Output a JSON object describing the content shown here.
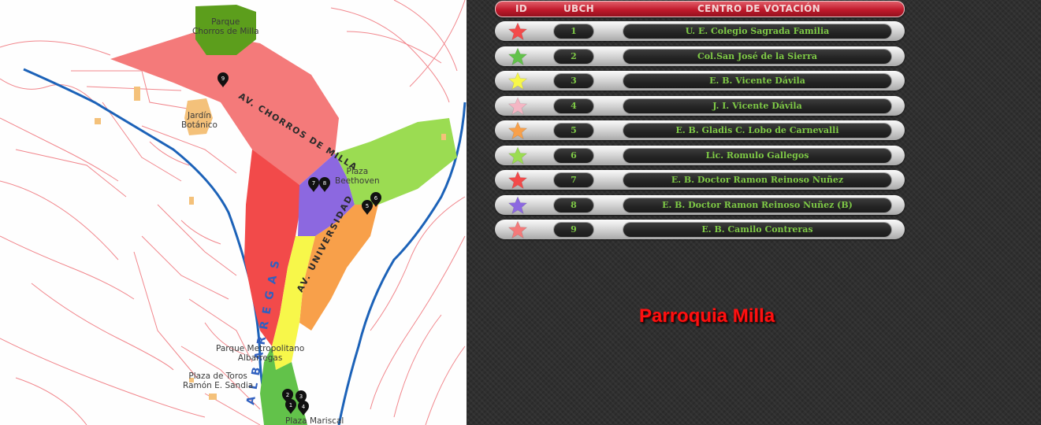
{
  "map": {
    "labels": {
      "parque_chorros": "Parque\nChorros de Milla",
      "jardin": "Jardín\nBotánico",
      "plaza_beethoven": "Plaza\nBeethoven",
      "parque_metropolitano": "Parque Metropolitano\nAlbarregas",
      "plaza_toros": "Plaza de Toros\nRamón E. Sandia",
      "plaza_bottom": "Plaza Mariscal"
    },
    "streets": {
      "chorros": "AV. CHORROS DE MILLA",
      "universidad": "AV. UNIVERSIDAD",
      "albarregas": "ALBARREGAS"
    },
    "markers": [
      "1",
      "2",
      "3",
      "4",
      "5",
      "6",
      "7",
      "8",
      "9"
    ]
  },
  "table": {
    "headers": {
      "id": "ID",
      "ubch": "UBCH",
      "centro": "CENTRO DE VOTACIÓN"
    },
    "rows": [
      {
        "id": "1",
        "name": "U. E. Colegio Sagrada Familia",
        "star_color": "#f24a4a"
      },
      {
        "id": "2",
        "name": "Col.San José de la Sierra",
        "star_color": "#62c24a"
      },
      {
        "id": "3",
        "name": "E. B. Vicente Dávila",
        "star_color": "#f7f74a"
      },
      {
        "id": "4",
        "name": "J. I. Vicente Dávila",
        "star_color": "#f4b6c4"
      },
      {
        "id": "5",
        "name": "E. B. Gladis C. Lobo de Carnevalli",
        "star_color": "#f8a04a"
      },
      {
        "id": "6",
        "name": "Lic. Romulo Gallegos",
        "star_color": "#9bdc52"
      },
      {
        "id": "7",
        "name": "E. B. Doctor Ramon Reinoso Nuñez",
        "star_color": "#f24a4a"
      },
      {
        "id": "8",
        "name": "E. B. Doctor Ramon Reinoso Nuñez (B)",
        "star_color": "#8c68e0"
      },
      {
        "id": "9",
        "name": "E. B. Camilo Contreras",
        "star_color": "#f47a7a"
      }
    ]
  },
  "title": "Parroquia Milla",
  "colors": {
    "title_red": "#ff1010",
    "name_green": "#7ec946",
    "header_red": "#c0192b"
  }
}
